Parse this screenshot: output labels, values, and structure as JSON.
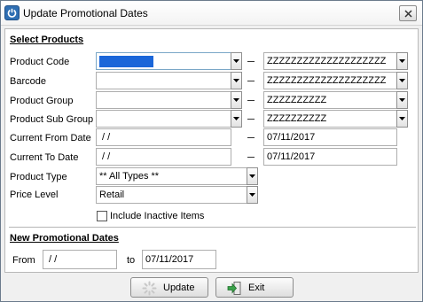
{
  "window": {
    "title": "Update Promotional Dates"
  },
  "select_products": {
    "section_title": "Select Products",
    "rows": {
      "product_code": {
        "label": "Product Code",
        "to_value": "ZZZZZZZZZZZZZZZZZZZZ"
      },
      "barcode": {
        "label": "Barcode",
        "to_value": "ZZZZZZZZZZZZZZZZZZZZ"
      },
      "product_group": {
        "label": "Product Group",
        "to_value": "ZZZZZZZZZZ"
      },
      "product_sub_group": {
        "label": "Product Sub Group",
        "to_value": "ZZZZZZZZZZ"
      },
      "current_from_date": {
        "label": "Current From Date",
        "from_value": " / /",
        "to_value": "07/11/2017"
      },
      "current_to_date": {
        "label": "Current To Date",
        "from_value": " / /",
        "to_value": "07/11/2017"
      }
    },
    "product_type": {
      "label": "Product Type",
      "value": "** All Types **"
    },
    "price_level": {
      "label": "Price Level",
      "value": "Retail"
    },
    "include_inactive": {
      "label": "Include Inactive Items",
      "checked": false
    }
  },
  "new_dates": {
    "section_title": "New Promotional Dates",
    "from_label": "From",
    "from_value": " / /",
    "to_label": "to",
    "to_value": "07/11/2017"
  },
  "buttons": {
    "update": "Update",
    "exit": "Exit"
  },
  "colors": {
    "selection": "#1a66d9",
    "app_icon": "#2f6fb3"
  },
  "icons": {
    "app": "power-icon",
    "close": "close-icon",
    "update": "spinner-icon",
    "exit": "exit-arrow-icon"
  }
}
